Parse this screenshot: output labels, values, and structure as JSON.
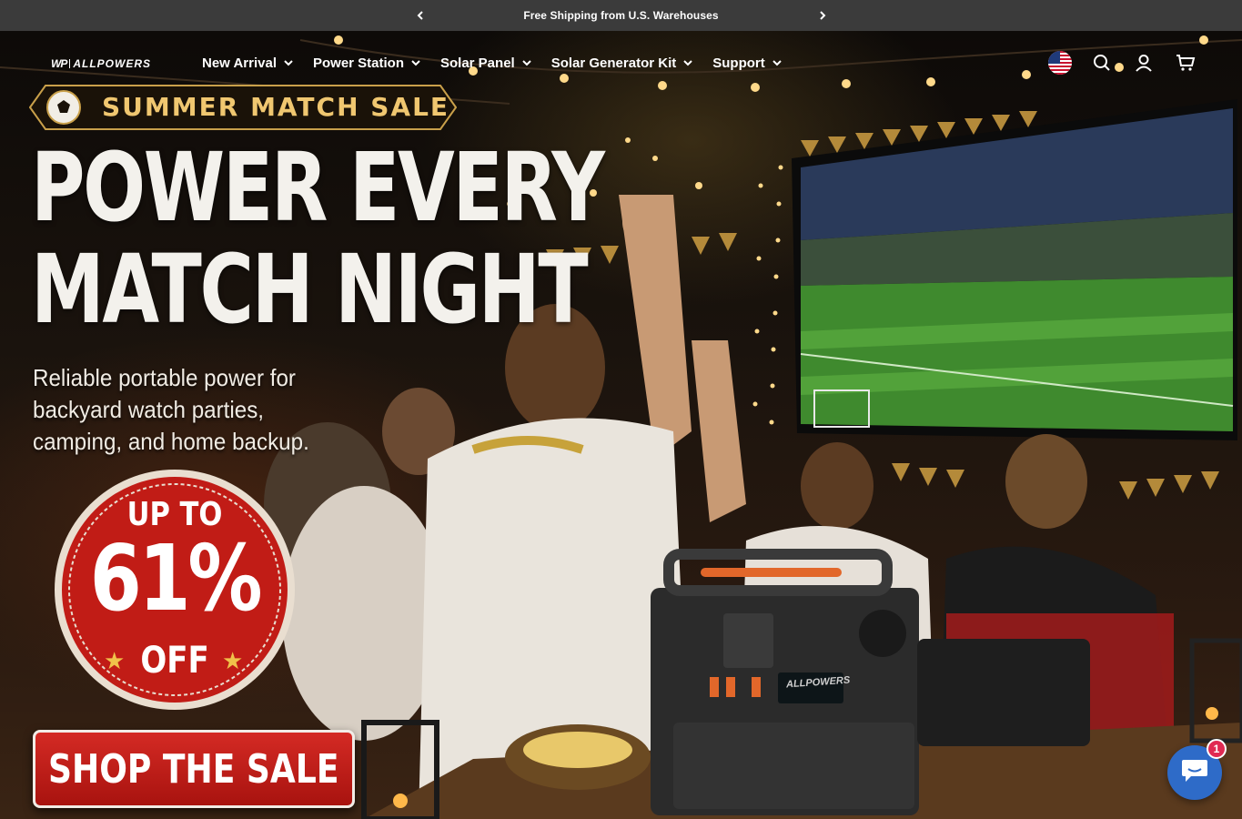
{
  "announcement": {
    "text": "Free Shipping from U.S. Warehouses",
    "prev_icon": "chevron-left-icon",
    "next_icon": "chevron-right-icon"
  },
  "header": {
    "logo_mark": "WP",
    "logo_word": "ALLPOWERS",
    "nav": [
      {
        "label": "New Arrival"
      },
      {
        "label": "Power Station"
      },
      {
        "label": "Solar Panel"
      },
      {
        "label": "Solar Generator Kit"
      },
      {
        "label": "Support"
      }
    ],
    "icons": [
      "us-flag-icon",
      "search-icon",
      "account-icon",
      "cart-icon"
    ]
  },
  "hero": {
    "badge": "SUMMER MATCH SALE",
    "headline_line1": "POWER EVERY",
    "headline_line2": "MATCH NIGHT",
    "subhead": "Reliable portable power for backyard watch parties, camping, and home backup.",
    "seal_top": "UP TO",
    "seal_value": "61%",
    "seal_bottom": "OFF",
    "cta": "SHOP THE SALE",
    "device_brand": "ALLPOWERS"
  },
  "chat": {
    "icon": "chat-icon",
    "badge_count": "1"
  },
  "colors": {
    "announcement_bg": "#3b3b3b",
    "badge_gold": "#f0c770",
    "sale_red": "#c11c16",
    "chat_blue": "#2e6bc8"
  }
}
